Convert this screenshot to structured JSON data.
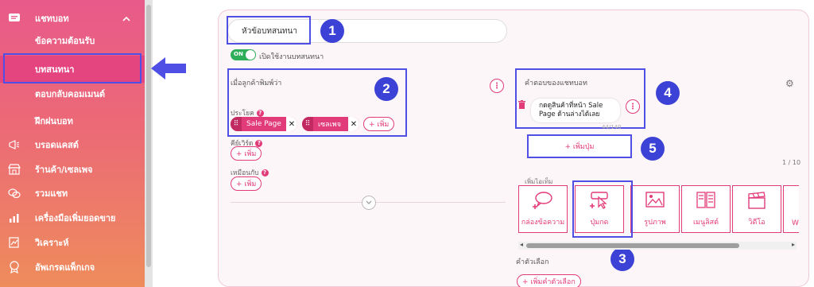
{
  "sidebar": {
    "chat_header": "แชทบอท",
    "sub_items": [
      "ข้อความต้อนรับ",
      "บทสนทนา",
      "ตอบกลับคอมเมนต์",
      "ฝึกฝนบอท"
    ],
    "items": [
      "บรอดแคสต์",
      "ร้านค้า/เซลเพจ",
      "รวมแชท",
      "เครื่องมือเพิ่มยอดขาย",
      "วิเคราะห์",
      "อัพเกรดแพ็กเกจ"
    ]
  },
  "conversation": {
    "title_value": "หัวข้อบทสนทนา",
    "toggle_on": "ON",
    "toggle_label": "เปิดใช้งานบทสนทนา"
  },
  "trigger": {
    "heading": "เมื่อลูกค้าพิมพ์ว่า",
    "sentence_label": "ประโยค",
    "tags": [
      "Sale Page",
      "เซลเพจ"
    ],
    "add_label": "+ เพิ่ม",
    "keyword_label": "คีย์เวิร์ด",
    "similar_label": "เหมือนกับ"
  },
  "reply": {
    "heading": "คำตอบของแชทบอท",
    "message": "กดดูสินค้าที่หน้า Sale Page ด้านล่างได้เลย",
    "counter": "44/140",
    "add_button": "+ เพิ่มปุ่ม",
    "pagination": "1 / 10",
    "add_item_label": "เพิ่มไอเท็ม",
    "templates": [
      "กล่องข้อความ",
      "ปุ่มกด",
      "รูปภาพ",
      "เมนูลิสต์",
      "วิดีโอ",
      "W"
    ],
    "options_label": "คำตัวเลือก",
    "add_option": "+ เพิ่มคำตัวเลือก"
  },
  "callouts": [
    "1",
    "2",
    "3",
    "4",
    "5"
  ],
  "colors": {
    "accent": "#e23b7a",
    "highlight": "#4f4fe6",
    "badge": "#3d42d6"
  }
}
